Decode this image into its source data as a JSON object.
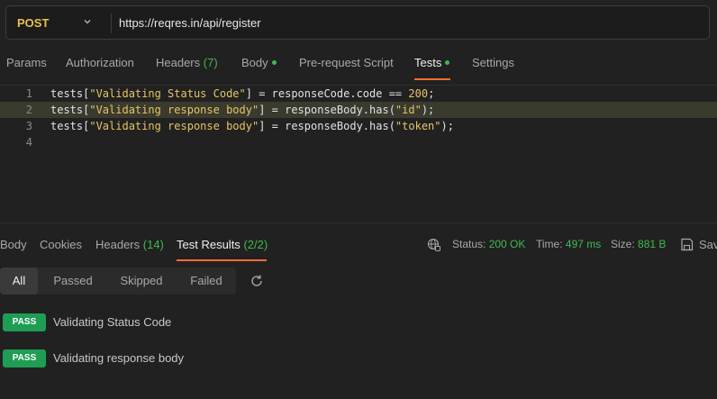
{
  "request": {
    "method": "POST",
    "url": "https://reqres.in/api/register"
  },
  "request_tabs": {
    "params": "Params",
    "authorization": "Authorization",
    "headers": "Headers",
    "headers_count": "(7)",
    "body": "Body",
    "prerequest": "Pre-request Script",
    "tests": "Tests",
    "settings": "Settings",
    "active": "Tests"
  },
  "editor": {
    "lines": [
      {
        "num": "1",
        "prefix": "tests[",
        "str": "\"Validating Status Code\"",
        "suffix": "] = responseCode.code == ",
        "num_lit": "200",
        "end": ";"
      },
      {
        "num": "2",
        "prefix": "tests[",
        "str": "\"Validating response body\"",
        "suffix": "] = responseBody.has(",
        "arg": "\"id\"",
        "end": ");"
      },
      {
        "num": "3",
        "prefix": "tests[",
        "str": "\"Validating response body\"",
        "suffix": "] = responseBody.has(",
        "arg": "\"token\"",
        "end": ");"
      },
      {
        "num": "4"
      }
    ]
  },
  "response_tabs": {
    "body": "Body",
    "cookies": "Cookies",
    "headers": "Headers",
    "headers_count": "(14)",
    "test_results": "Test Results",
    "test_results_count": "(2/2)",
    "active": "Test Results"
  },
  "status": {
    "status_label": "Status:",
    "status_value": "200 OK",
    "time_label": "Time:",
    "time_value": "497 ms",
    "size_label": "Size:",
    "size_value": "881 B",
    "save_label": "Sav"
  },
  "filters": {
    "all": "All",
    "passed": "Passed",
    "skipped": "Skipped",
    "failed": "Failed",
    "active": "All"
  },
  "results": [
    {
      "badge": "PASS",
      "name": "Validating Status Code"
    },
    {
      "badge": "PASS",
      "name": "Validating response body"
    }
  ],
  "colors": {
    "accent": "#ff6c37",
    "success": "#3fb950",
    "method": "#e8c04a",
    "pass_badge": "#1f9d55"
  }
}
